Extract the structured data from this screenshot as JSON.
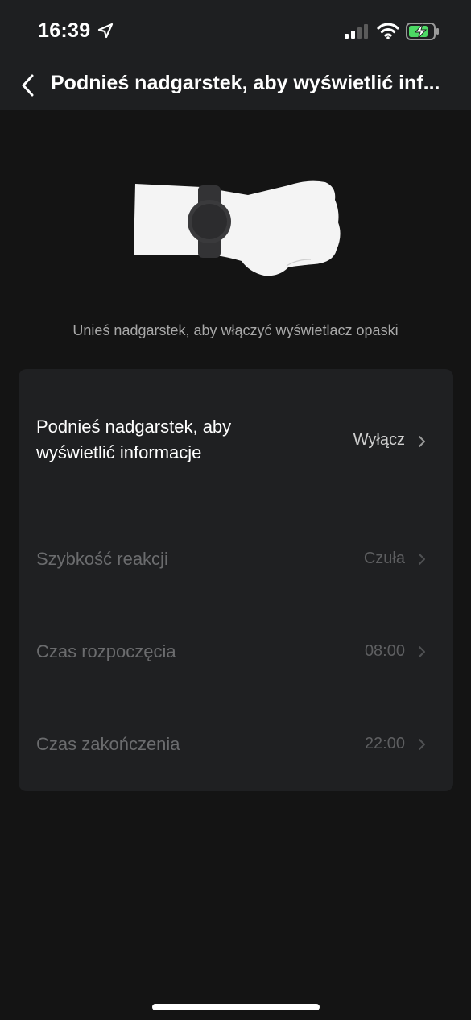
{
  "status_bar": {
    "time": "16:39",
    "icons": [
      "location-arrow-icon",
      "cellular-signal-icon",
      "wifi-icon",
      "battery-charging-icon"
    ]
  },
  "header": {
    "back_icon": "chevron-left-icon",
    "title": "Podnieś nadgarstek, aby wyświetlić inf..."
  },
  "illustration": {
    "description_icon": "wrist-with-band-illustration"
  },
  "description": "Unieś nadgarstek, aby włączyć wyświetlacz opaski",
  "settings": {
    "rows": [
      {
        "label_line1": "Podnieś nadgarstek, aby",
        "label_line2": "wyświetlić informacje",
        "value": "Wyłącz",
        "enabled": true
      },
      {
        "label": "Szybkość reakcji",
        "value": "Czuła",
        "enabled": false
      },
      {
        "label": "Czas rozpoczęcia",
        "value": "08:00",
        "enabled": false
      },
      {
        "label": "Czas zakończenia",
        "value": "22:00",
        "enabled": false
      }
    ]
  },
  "colors": {
    "background": "#141414",
    "header_background": "#1e1f21",
    "card_background": "#1f2022",
    "text_primary": "#ffffff",
    "text_secondary": "#a9a9a9",
    "text_disabled": "#6b6c6e",
    "battery_charge": "#4cd964"
  }
}
